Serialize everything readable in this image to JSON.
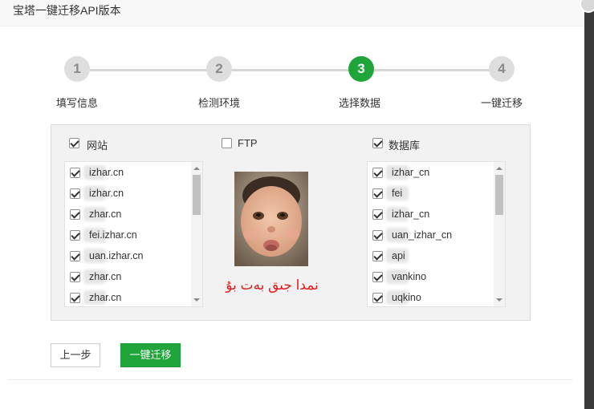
{
  "dialog": {
    "title": "宝塔一键迁移API版本"
  },
  "steps": [
    {
      "number": "1",
      "label": "填写信息",
      "active": false
    },
    {
      "number": "2",
      "label": "检测环境",
      "active": false
    },
    {
      "number": "3",
      "label": "选择数据",
      "active": true
    },
    {
      "number": "4",
      "label": "一键迁移",
      "active": false
    }
  ],
  "panel": {
    "sites": {
      "label": "网站",
      "checked": true,
      "items": [
        "izhar.cn",
        "izhar.cn",
        "zhar.cn",
        "fei.izhar.cn",
        "uan.izhar.cn",
        "zhar.cn",
        "zhar.cn"
      ]
    },
    "ftp": {
      "label": "FTP",
      "checked": false
    },
    "databases": {
      "label": "数据库",
      "checked": true,
      "items": [
        "izhar_cn",
        "fei",
        "izhar_cn",
        "uan_izhar_cn",
        "api",
        "vankino",
        "uqkino"
      ]
    },
    "caption": "نمدا جىق بەت بۇ"
  },
  "buttons": {
    "prev": "上一步",
    "migrate": "一键迁移"
  },
  "colors": {
    "accent": "#20a53a",
    "caption": "#e31b1b"
  }
}
